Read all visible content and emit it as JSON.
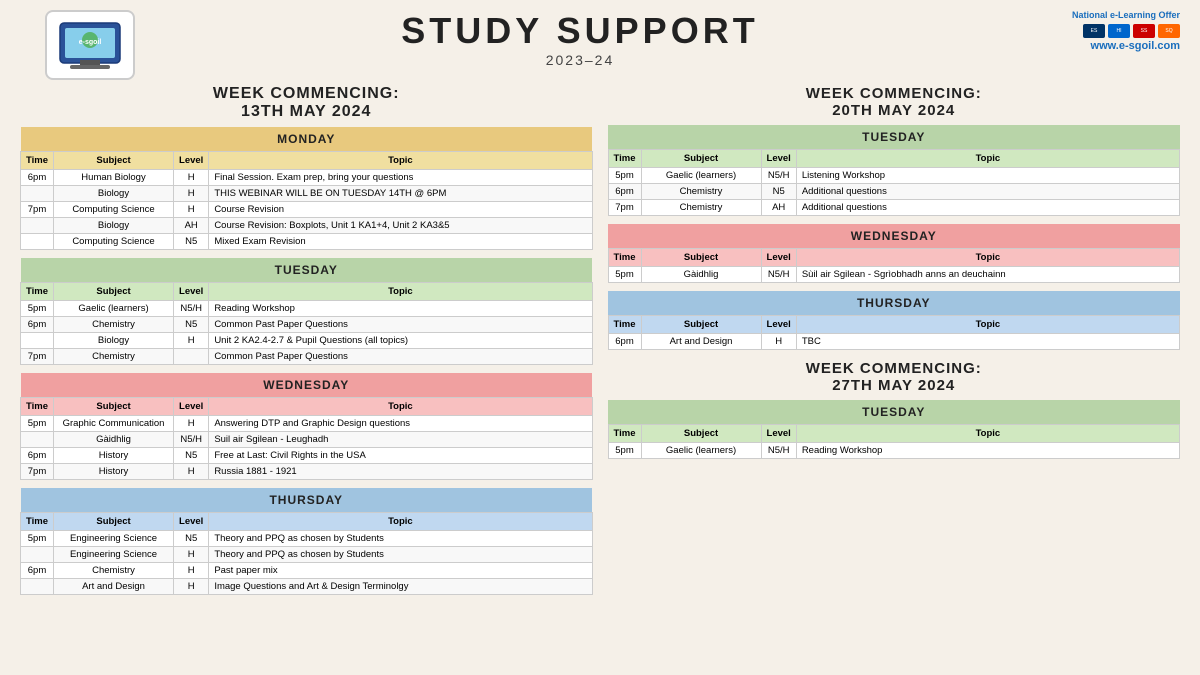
{
  "header": {
    "title": "STUDY SUPPORT",
    "year": "2023–24",
    "logo_text": "e-sgoil",
    "website": "www.e-sgoil.com",
    "national_label": "National e-Learning Offer"
  },
  "left_week": {
    "heading_line1": "WEEK COMMENCING:",
    "heading_line2": "13TH MAY 2024",
    "days": [
      {
        "day": "MONDAY",
        "header_class": "day-header-monday",
        "col_class": "col-header-monday",
        "rows": [
          {
            "time": "6pm",
            "subject": "Human Biology",
            "level": "H",
            "topic": "Final Session. Exam prep, bring your questions"
          },
          {
            "time": "",
            "subject": "Biology",
            "level": "H",
            "topic": "THIS WEBINAR WILL BE ON TUESDAY 14TH @ 6PM"
          },
          {
            "time": "7pm",
            "subject": "Computing Science",
            "level": "H",
            "topic": "Course Revision"
          },
          {
            "time": "",
            "subject": "Biology",
            "level": "AH",
            "topic": "Course Revision: Boxplots, Unit 1 KA1+4, Unit 2 KA3&5"
          },
          {
            "time": "",
            "subject": "Computing Science",
            "level": "N5",
            "topic": "Mixed Exam Revision"
          }
        ]
      },
      {
        "day": "TUESDAY",
        "header_class": "day-header-tuesday",
        "col_class": "col-header-tuesday",
        "rows": [
          {
            "time": "5pm",
            "subject": "Gaelic (learners)",
            "level": "N5/H",
            "topic": "Reading Workshop"
          },
          {
            "time": "6pm",
            "subject": "Chemistry",
            "level": "N5",
            "topic": "Common Past Paper Questions"
          },
          {
            "time": "",
            "subject": "Biology",
            "level": "H",
            "topic": "Unit 2 KA2.4-2.7 & Pupil Questions (all topics)"
          },
          {
            "time": "7pm",
            "subject": "Chemistry",
            "level": "",
            "topic": "Common Past Paper Questions"
          }
        ]
      },
      {
        "day": "WEDNESDAY",
        "header_class": "day-header-wednesday",
        "col_class": "col-header-wednesday",
        "rows": [
          {
            "time": "5pm",
            "subject": "Graphic Communication",
            "level": "H",
            "topic": "Answering DTP and Graphic Design questions"
          },
          {
            "time": "",
            "subject": "Gàidhlig",
            "level": "N5/H",
            "topic": "Suil air Sgilean - Leughadh"
          },
          {
            "time": "6pm",
            "subject": "History",
            "level": "N5",
            "topic": "Free at Last: Civil Rights in the USA"
          },
          {
            "time": "7pm",
            "subject": "History",
            "level": "H",
            "topic": "Russia 1881 - 1921"
          }
        ]
      },
      {
        "day": "THURSDAY",
        "header_class": "day-header-thursday",
        "col_class": "col-header-thursday",
        "rows": [
          {
            "time": "5pm",
            "subject": "Engineering Science",
            "level": "N5",
            "topic": "Theory and PPQ as chosen by Students"
          },
          {
            "time": "",
            "subject": "Engineering Science",
            "level": "H",
            "topic": "Theory and PPQ as chosen by Students"
          },
          {
            "time": "6pm",
            "subject": "Chemistry",
            "level": "H",
            "topic": "Past paper mix"
          },
          {
            "time": "",
            "subject": "Art and Design",
            "level": "H",
            "topic": "Image Questions and Art & Design Terminolgy"
          }
        ]
      }
    ]
  },
  "right_week1": {
    "heading_line1": "WEEK COMMENCING:",
    "heading_line2": "20TH MAY 2024",
    "days": [
      {
        "day": "TUESDAY",
        "header_class": "day-header-tuesday",
        "col_class": "col-header-tuesday",
        "rows": [
          {
            "time": "5pm",
            "subject": "Gaelic (learners)",
            "level": "N5/H",
            "topic": "Listening Workshop"
          },
          {
            "time": "6pm",
            "subject": "Chemistry",
            "level": "N5",
            "topic": "Additional questions"
          },
          {
            "time": "7pm",
            "subject": "Chemistry",
            "level": "AH",
            "topic": "Additional questions"
          }
        ]
      },
      {
        "day": "WEDNESDAY",
        "header_class": "day-header-wednesday",
        "col_class": "col-header-wednesday",
        "rows": [
          {
            "time": "5pm",
            "subject": "Gàidhlig",
            "level": "N5/H",
            "topic": "Sùil air Sgilean - Sgrìobhadh anns an deuchainn"
          }
        ]
      },
      {
        "day": "THURSDAY",
        "header_class": "day-header-thursday",
        "col_class": "col-header-thursday",
        "rows": [
          {
            "time": "6pm",
            "subject": "Art and Design",
            "level": "H",
            "topic": "TBC"
          }
        ]
      }
    ]
  },
  "right_week2": {
    "heading_line1": "WEEK COMMENCING:",
    "heading_line2": "27TH MAY 2024",
    "days": [
      {
        "day": "TUESDAY",
        "header_class": "day-header-tuesday",
        "col_class": "col-header-tuesday",
        "rows": [
          {
            "time": "5pm",
            "subject": "Gaelic (learners)",
            "level": "N5/H",
            "topic": "Reading Workshop"
          }
        ]
      }
    ]
  }
}
